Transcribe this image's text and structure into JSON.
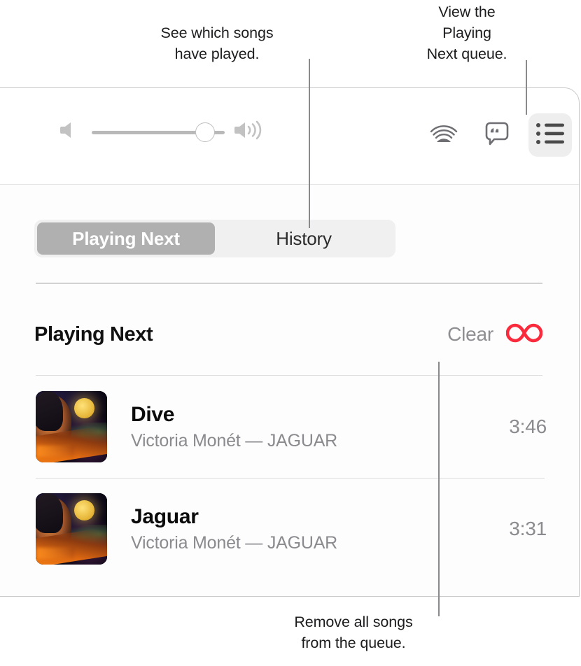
{
  "callouts": [
    {
      "id": "history",
      "text": "See which songs\nhave played."
    },
    {
      "id": "queue",
      "text": "View the\nPlaying\nNext queue."
    },
    {
      "id": "clear",
      "text": "Remove all songs\nfrom the queue."
    }
  ],
  "toolbar": {
    "volume": {
      "min_icon": "speaker-min-icon",
      "max_icon": "speaker-max-icon",
      "value_percent": 80
    },
    "buttons": [
      {
        "name": "airplay-button",
        "icon": "airplay-icon",
        "active": false
      },
      {
        "name": "lyrics-button",
        "icon": "lyrics-icon",
        "active": false
      },
      {
        "name": "queue-button",
        "icon": "queue-list-icon",
        "active": true
      }
    ]
  },
  "queue_panel": {
    "tabs": [
      {
        "label": "Playing Next",
        "selected": true
      },
      {
        "label": "History",
        "selected": false
      }
    ],
    "section_title": "Playing Next",
    "clear_label": "Clear",
    "autoplay_icon": "infinity-icon",
    "autoplay_color": "#fa2b3c",
    "tracks": [
      {
        "title": "Dive",
        "subtitle": "Victoria Monét — JAGUAR",
        "duration": "3:46",
        "artwork": "album-art-jaguar"
      },
      {
        "title": "Jaguar",
        "subtitle": "Victoria Monét — JAGUAR",
        "duration": "3:31",
        "artwork": "album-art-jaguar"
      }
    ]
  }
}
